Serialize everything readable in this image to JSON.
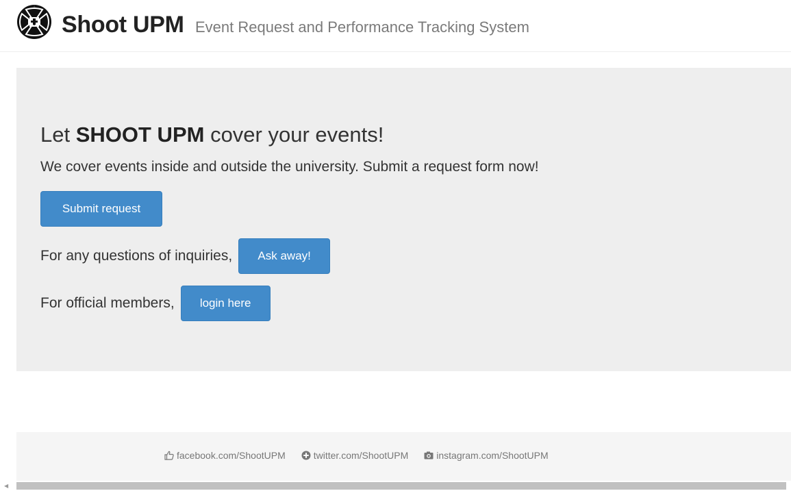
{
  "header": {
    "brand": "Shoot UPM",
    "subtitle": "Event Request and Performance Tracking System",
    "logo_icon": "shutter-logo-icon"
  },
  "hero": {
    "heading_prefix": "Let ",
    "heading_bold": "SHOOT UPM",
    "heading_suffix": " cover your events!",
    "lead": "We cover events inside and outside the university. Submit a request form now!",
    "submit_button": "Submit request",
    "ask_text": "For any questions of inquiries,",
    "ask_button": "Ask away!",
    "login_text": "For official members,",
    "login_button": "login here"
  },
  "footer": {
    "links": [
      {
        "icon": "thumbs-up-icon",
        "label": "facebook.com/ShootUPM"
      },
      {
        "icon": "plus-circle-icon",
        "label": "twitter.com/ShootUPM"
      },
      {
        "icon": "camera-icon",
        "label": "instagram.com/ShootUPM"
      }
    ]
  },
  "colors": {
    "primary_button": "#428bca",
    "hero_background": "#eeeeee",
    "footer_background": "#f5f5f5"
  }
}
